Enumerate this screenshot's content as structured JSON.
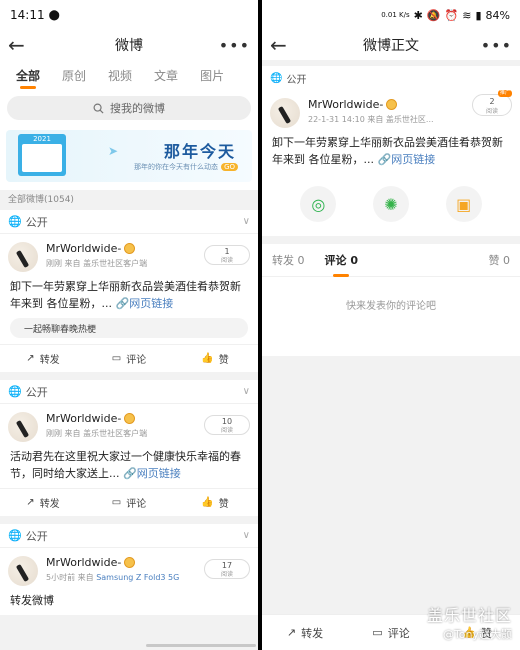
{
  "left": {
    "status": {
      "time": "14:11"
    },
    "nav": {
      "title": "微博"
    },
    "tabs": [
      "全部",
      "原创",
      "视频",
      "文章",
      "图片"
    ],
    "search": {
      "placeholder": "搜我的微博"
    },
    "banner": {
      "title": "那年今天",
      "subtitle": "那年的你在今天有什么动态",
      "go": "GO"
    },
    "section_title": "全部微博(1054)",
    "posts": [
      {
        "visibility": "公开",
        "user": "MrWorldwide-",
        "time": "刚刚",
        "source_prefix": "来自",
        "device": "盖乐世社区客户端",
        "reads": "1",
        "reads_label": "阅读",
        "text": "卸下一年劳累穿上华丽新衣品尝美酒佳肴恭贺新年来到 各位星粉，...",
        "link": "网页链接",
        "topic": "一起畅聊春晚热梗",
        "actions": [
          "转发",
          "评论",
          "赞"
        ]
      },
      {
        "visibility": "公开",
        "user": "MrWorldwide-",
        "time": "刚刚",
        "source_prefix": "来自",
        "device": "盖乐世社区客户端",
        "reads": "10",
        "reads_label": "阅读",
        "text": "活动君先在这里祝大家过一个健康快乐幸福的春节，同时给大家送上...",
        "link": "网页链接",
        "actions": [
          "转发",
          "评论",
          "赞"
        ]
      },
      {
        "visibility": "公开",
        "user": "MrWorldwide-",
        "time": "5小时前",
        "source_prefix": "来自",
        "device": "Samsung Z Fold3 5G",
        "reads": "17",
        "reads_label": "阅读",
        "text": "转发微博"
      }
    ]
  },
  "right": {
    "status": {
      "battery": "84%",
      "speed": "0.01 K/s"
    },
    "nav": {
      "title": "微博正文"
    },
    "visibility": "公开",
    "post": {
      "user": "MrWorldwide-",
      "time": "22-1-31 14:10",
      "source_prefix": "来自",
      "device": "盖乐世社区...",
      "reads": "2",
      "reads_label": "阅读",
      "tag": "推广",
      "text": "卸下一年劳累穿上华丽新衣品尝美酒佳肴恭贺新年来到 各位星粉，...",
      "link": "网页链接"
    },
    "comment_tabs": {
      "repost": "转发 0",
      "comment": "评论 0",
      "likes": "赞 0"
    },
    "empty_text": "快来发表你的评论吧",
    "bottom": [
      "转发",
      "评论",
      "赞"
    ]
  },
  "watermark": {
    "line1": "盖乐世社区",
    "line2": "@Tony赵大颢"
  }
}
